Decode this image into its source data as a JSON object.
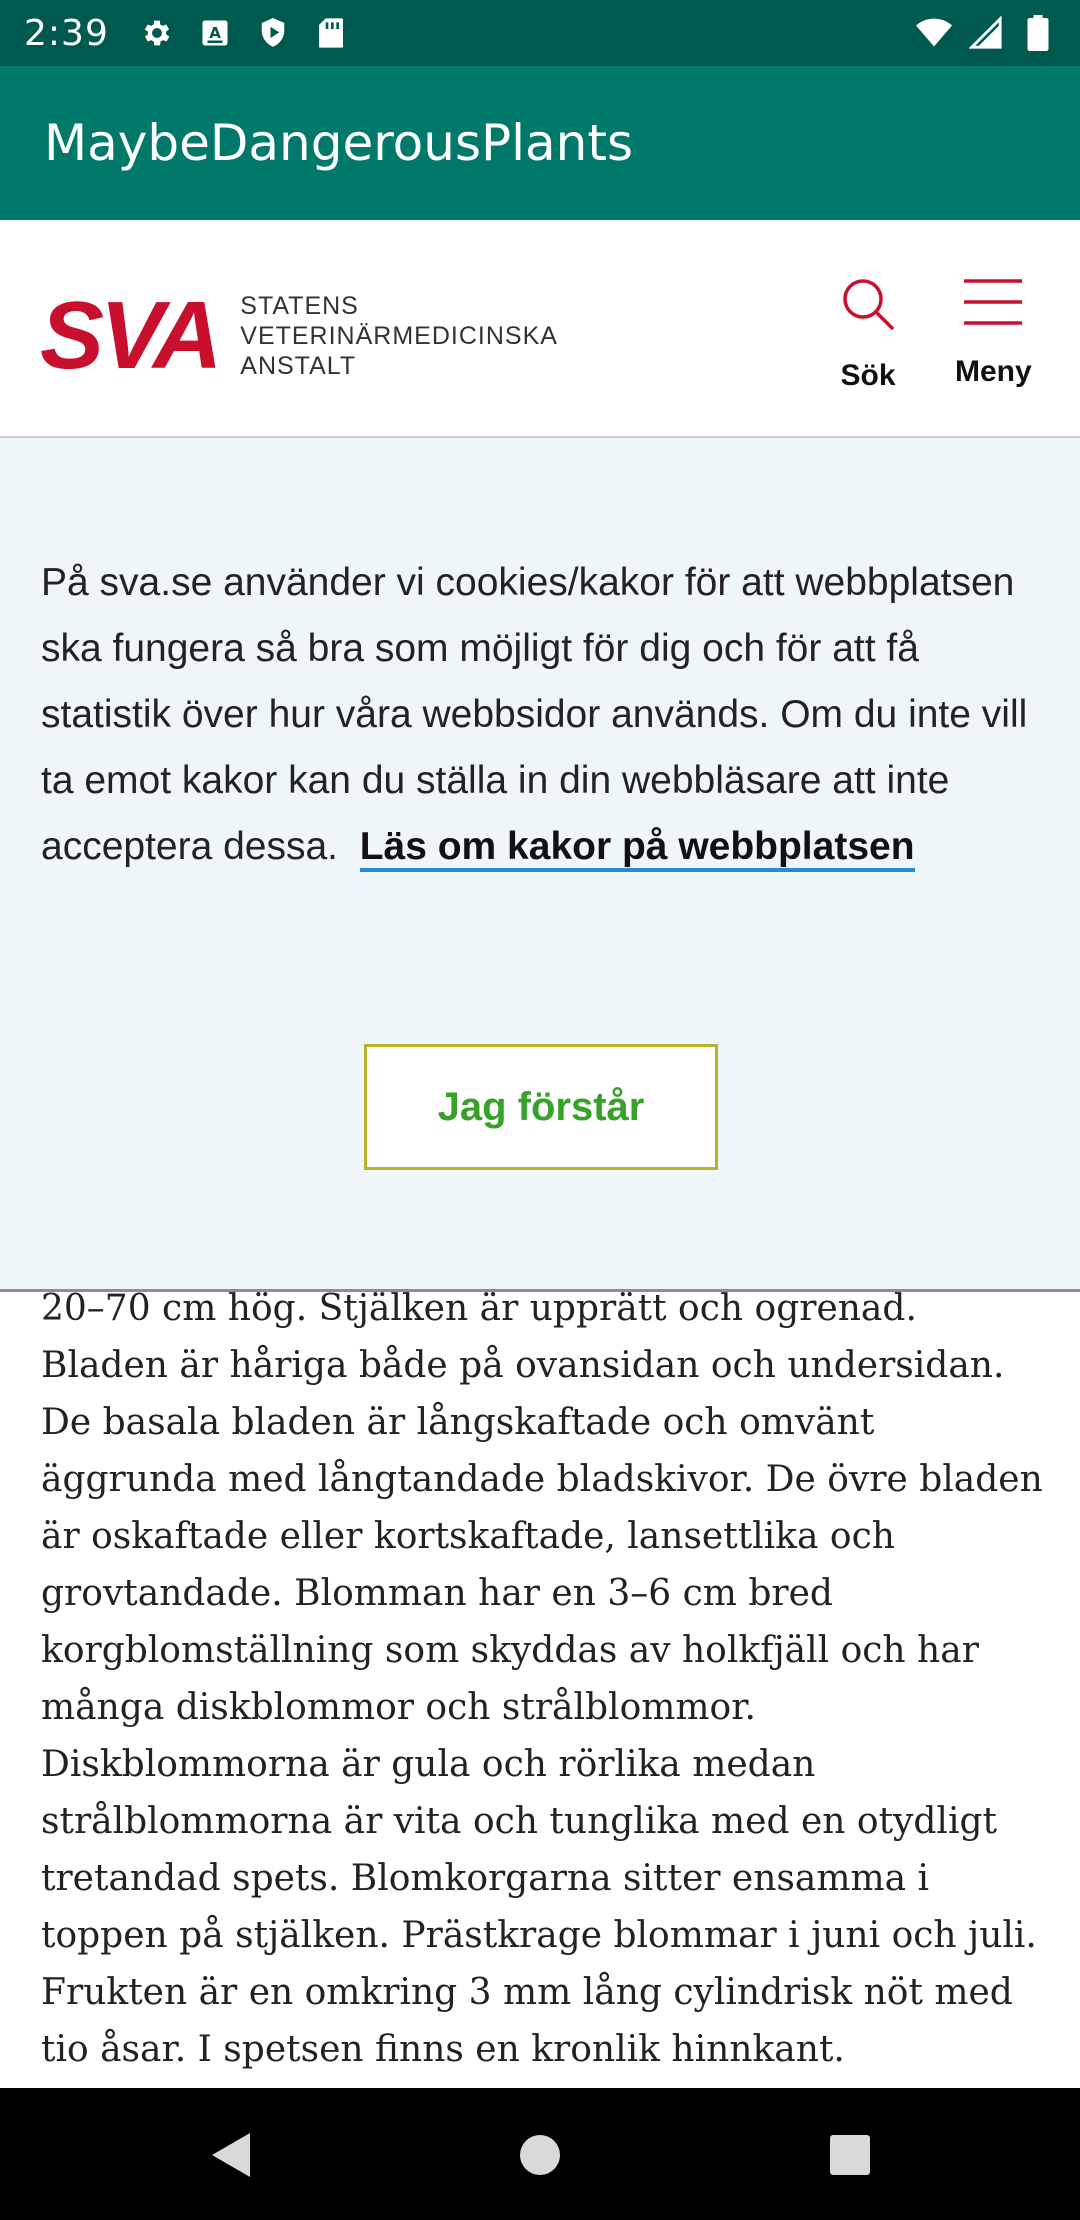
{
  "status_bar": {
    "time": "2:39",
    "icons_left": [
      "gear-icon",
      "font-a-icon",
      "shield-icon",
      "sd-card-icon"
    ],
    "icons_right": [
      "wifi-icon",
      "signal-icon",
      "battery-icon"
    ]
  },
  "app_bar": {
    "title": "MaybeDangerousPlants"
  },
  "site_header": {
    "logo_mark": "SVA",
    "logo_lines": [
      "STATENS",
      "VETERINÄRMEDICINSKA",
      "ANSTALT"
    ],
    "search_label": "Sök",
    "menu_label": "Meny"
  },
  "cookie_banner": {
    "text": "På sva.se använder vi cookies/kakor för att webbplatsen ska fungera så bra som möjligt för dig och för att få statistik över hur våra webbsidor används. Om du inte vill ta emot kakor kan du ställa in din webbläsare att inte acceptera dessa.",
    "link_text": "Läs om kakor på webbplatsen",
    "accept_label": "Jag förstår"
  },
  "article": {
    "text": "20–70 cm hög. Stjälken är upprätt och ogrenad. Bladen är håriga både på ovansidan och undersidan. De basala bladen är långskaftade och omvänt äggrunda med långtandade bladskivor. De övre bladen är oskaftade eller kortskaftade, lansettlika och grovtandade. Blomman har en 3–6 cm bred korgblomställning som skyddas av holkfjäll och har många diskblommor och strålblommor. Diskblommorna är gula och rörlika medan strålblommorna är vita och tunglika med en otydligt tretandad spets. Blomkorgarna sitter ensamma i toppen på stjälken. Prästkrage blommar i juni och juli. Frukten är en omkring 3 mm lång cylindrisk nöt med tio åsar. I spetsen finns en kronlik hinnkant."
  },
  "colors": {
    "status_bar": "#00594f",
    "app_bar": "#00796b",
    "sva_red": "#c8102e",
    "banner_bg": "#eff6f9",
    "link_underline": "#2b8ad6",
    "accept_text": "#37a12a",
    "accept_border": "#b5b32a"
  }
}
